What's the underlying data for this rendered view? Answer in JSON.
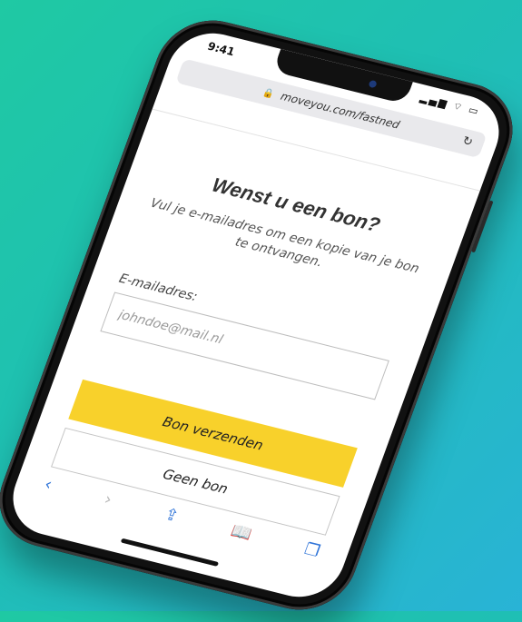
{
  "status": {
    "time": "9:41",
    "icons": "▂▄▆ ⌔ ▭"
  },
  "browser": {
    "url": "moveyou.com/fastned",
    "lock_icon": "lock-icon",
    "reload_icon": "reload-icon"
  },
  "page": {
    "heading": "Wenst u een bon?",
    "subtext": "Vul je e-mailadres om een kopie van je bon te ontvangen.",
    "email_label": "E-mailadres:",
    "email_placeholder": "johndoe@mail.nl",
    "primary_button": "Bon verzenden",
    "secondary_button": "Geen bon"
  },
  "toolbar": {
    "back": "‹",
    "forward": "›",
    "share": "⇪",
    "bookmarks": "📖",
    "tabs": "❐"
  },
  "colors": {
    "primary_button": "#f8d12b",
    "accent": "#2f74d8",
    "background_start": "#1fc9a3",
    "background_end": "#29b3d6"
  }
}
